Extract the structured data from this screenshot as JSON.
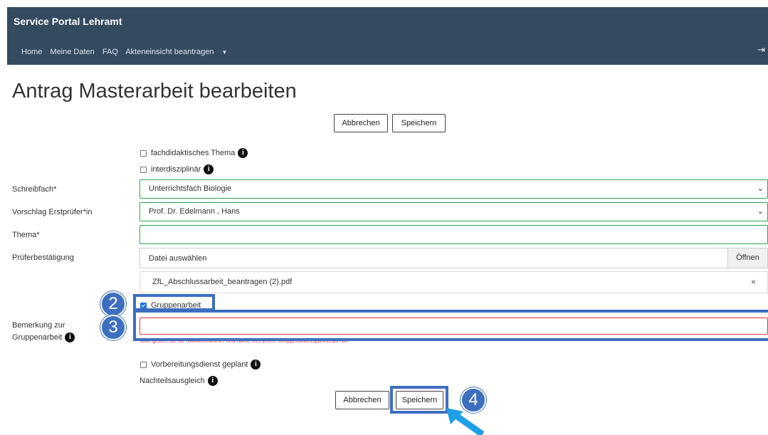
{
  "header": {
    "brand": "Service Portal Lehramt",
    "nav": [
      "Home",
      "Meine Daten",
      "FAQ",
      "Akteneinsicht beantragen"
    ],
    "logout_icon": "sign-out-icon"
  },
  "page_title": "Antrag Masterarbeit bearbeiten",
  "buttons": {
    "cancel": "Abbrechen",
    "save": "Speichern"
  },
  "checkboxes": {
    "fachdidaktisch": {
      "label": "fachdidaktisches Thema",
      "checked": false
    },
    "interdisziplinaer": {
      "label": "interdisziplinär",
      "checked": false
    },
    "gruppenarbeit": {
      "label": "Gruppenarbeit",
      "checked": true
    },
    "vorbereitungsdienst": {
      "label": "Vorbereitungsdienst geplant",
      "checked": false
    }
  },
  "fields": {
    "schreibfach": {
      "label": "Schreibfach*",
      "value": "Unterrichtsfach Biologie"
    },
    "erstpruefer": {
      "label": "Vorschlag Erstprüfer*in",
      "value": "Prof. Dr. Edelmann , Hans"
    },
    "thema": {
      "label": "Thema*",
      "value": ""
    },
    "prueferbestaetigung": {
      "label": "Prüferbestätigung",
      "file_placeholder": "Datei auswählen",
      "open_label": "Öffnen",
      "uploaded_file": "ZfL_Abschlussarbeit_beantragen (2).pdf",
      "remove_symbol": "×"
    },
    "bemerkung": {
      "label_line1": "Bemerkung zur",
      "label_line2": "Gruppenarbeit",
      "value": "",
      "hint": "Bitte geben Sie die Matrikelnummer und Name Ihres/Ihrer Gruppenarbeitspartners/in an."
    }
  },
  "nachteilsausgleich": "Nachteilsausgleich",
  "info_symbol": "i",
  "annotations": {
    "step2": "2",
    "step3": "3",
    "step4": "4"
  },
  "colors": {
    "navbar": "#344a5f",
    "annotation": "#3d6ebf",
    "valid": "#2ea44f",
    "invalid": "#dc3545",
    "arrow": "#1e9fe6"
  }
}
